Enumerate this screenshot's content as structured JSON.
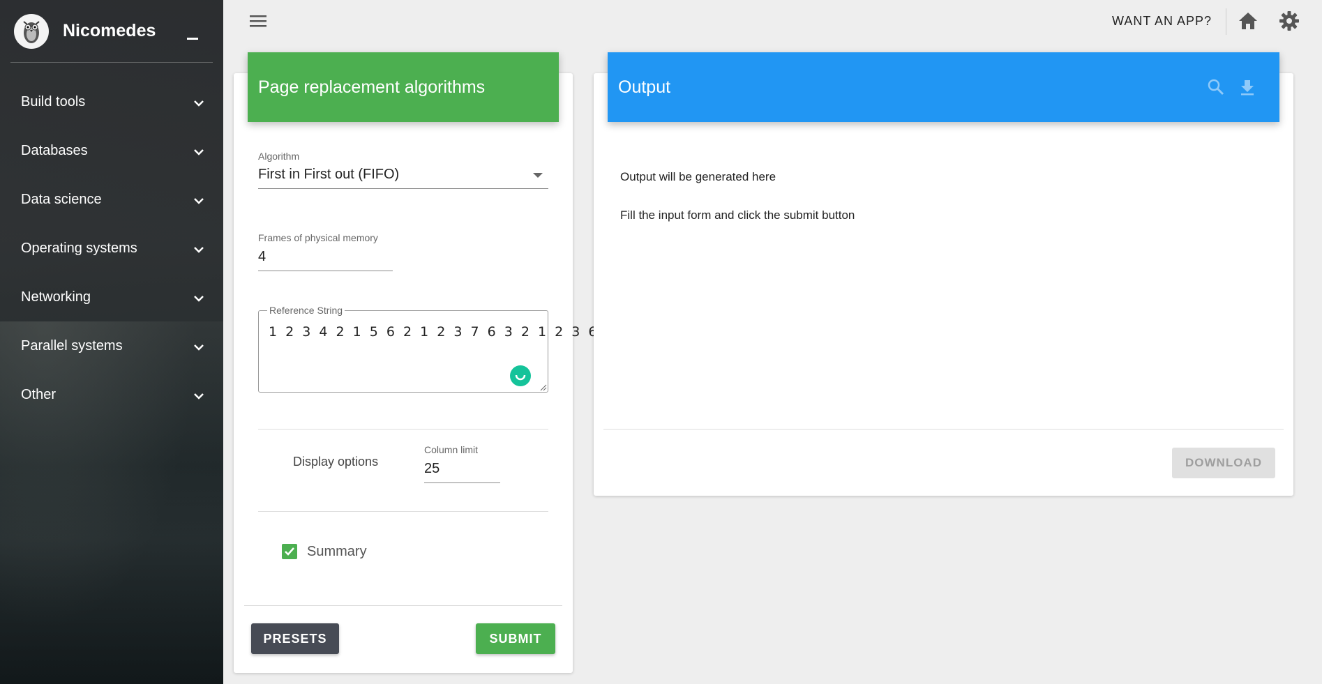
{
  "sidebar": {
    "brand_name": "Nicomedes",
    "items": [
      {
        "label": "Build tools"
      },
      {
        "label": "Databases"
      },
      {
        "label": "Data science"
      },
      {
        "label": "Operating systems"
      },
      {
        "label": "Networking"
      },
      {
        "label": "Parallel systems"
      },
      {
        "label": "Other"
      }
    ]
  },
  "topbar": {
    "want_app": "WANT AN APP?"
  },
  "form": {
    "title": "Page replacement algorithms",
    "algorithm_label": "Algorithm",
    "algorithm_value": "First in First out (FIFO)",
    "frames_label": "Frames of physical memory",
    "frames_value": "4",
    "reference_label": "Reference String",
    "reference_value": "1 2 3 4 2 1 5 6 2 1 2 3 7 6 3 2 1 2 3 6",
    "display_options": "Display options",
    "column_limit_label": "Column limit",
    "column_limit_value": "25",
    "summary_label": "Summary",
    "summary_checked": true,
    "presets_button": "PRESETS",
    "submit_button": "SUBMIT"
  },
  "output": {
    "title": "Output",
    "line1": "Output will be generated here",
    "line2": "Fill the input form and click the submit button",
    "download_button": "DOWNLOAD"
  },
  "colors": {
    "form_header": "#4caf50",
    "output_header": "#2196f3",
    "presets": "#474b55",
    "submit": "#4caf50"
  }
}
